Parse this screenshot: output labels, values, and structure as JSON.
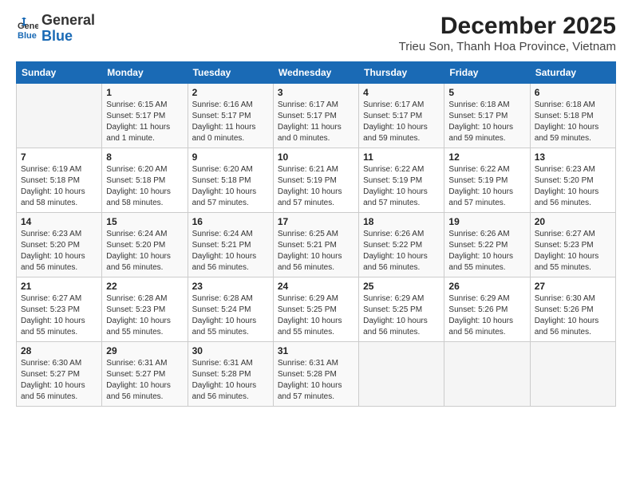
{
  "logo": {
    "general": "General",
    "blue": "Blue"
  },
  "header": {
    "month": "December 2025",
    "location": "Trieu Son, Thanh Hoa Province, Vietnam"
  },
  "weekdays": [
    "Sunday",
    "Monday",
    "Tuesday",
    "Wednesday",
    "Thursday",
    "Friday",
    "Saturday"
  ],
  "weeks": [
    [
      {
        "day": "",
        "sunrise": "",
        "sunset": "",
        "daylight": ""
      },
      {
        "day": "1",
        "sunrise": "Sunrise: 6:15 AM",
        "sunset": "Sunset: 5:17 PM",
        "daylight": "Daylight: 11 hours and 1 minute."
      },
      {
        "day": "2",
        "sunrise": "Sunrise: 6:16 AM",
        "sunset": "Sunset: 5:17 PM",
        "daylight": "Daylight: 11 hours and 0 minutes."
      },
      {
        "day": "3",
        "sunrise": "Sunrise: 6:17 AM",
        "sunset": "Sunset: 5:17 PM",
        "daylight": "Daylight: 11 hours and 0 minutes."
      },
      {
        "day": "4",
        "sunrise": "Sunrise: 6:17 AM",
        "sunset": "Sunset: 5:17 PM",
        "daylight": "Daylight: 10 hours and 59 minutes."
      },
      {
        "day": "5",
        "sunrise": "Sunrise: 6:18 AM",
        "sunset": "Sunset: 5:17 PM",
        "daylight": "Daylight: 10 hours and 59 minutes."
      },
      {
        "day": "6",
        "sunrise": "Sunrise: 6:18 AM",
        "sunset": "Sunset: 5:18 PM",
        "daylight": "Daylight: 10 hours and 59 minutes."
      }
    ],
    [
      {
        "day": "7",
        "sunrise": "Sunrise: 6:19 AM",
        "sunset": "Sunset: 5:18 PM",
        "daylight": "Daylight: 10 hours and 58 minutes."
      },
      {
        "day": "8",
        "sunrise": "Sunrise: 6:20 AM",
        "sunset": "Sunset: 5:18 PM",
        "daylight": "Daylight: 10 hours and 58 minutes."
      },
      {
        "day": "9",
        "sunrise": "Sunrise: 6:20 AM",
        "sunset": "Sunset: 5:18 PM",
        "daylight": "Daylight: 10 hours and 57 minutes."
      },
      {
        "day": "10",
        "sunrise": "Sunrise: 6:21 AM",
        "sunset": "Sunset: 5:19 PM",
        "daylight": "Daylight: 10 hours and 57 minutes."
      },
      {
        "day": "11",
        "sunrise": "Sunrise: 6:22 AM",
        "sunset": "Sunset: 5:19 PM",
        "daylight": "Daylight: 10 hours and 57 minutes."
      },
      {
        "day": "12",
        "sunrise": "Sunrise: 6:22 AM",
        "sunset": "Sunset: 5:19 PM",
        "daylight": "Daylight: 10 hours and 57 minutes."
      },
      {
        "day": "13",
        "sunrise": "Sunrise: 6:23 AM",
        "sunset": "Sunset: 5:20 PM",
        "daylight": "Daylight: 10 hours and 56 minutes."
      }
    ],
    [
      {
        "day": "14",
        "sunrise": "Sunrise: 6:23 AM",
        "sunset": "Sunset: 5:20 PM",
        "daylight": "Daylight: 10 hours and 56 minutes."
      },
      {
        "day": "15",
        "sunrise": "Sunrise: 6:24 AM",
        "sunset": "Sunset: 5:20 PM",
        "daylight": "Daylight: 10 hours and 56 minutes."
      },
      {
        "day": "16",
        "sunrise": "Sunrise: 6:24 AM",
        "sunset": "Sunset: 5:21 PM",
        "daylight": "Daylight: 10 hours and 56 minutes."
      },
      {
        "day": "17",
        "sunrise": "Sunrise: 6:25 AM",
        "sunset": "Sunset: 5:21 PM",
        "daylight": "Daylight: 10 hours and 56 minutes."
      },
      {
        "day": "18",
        "sunrise": "Sunrise: 6:26 AM",
        "sunset": "Sunset: 5:22 PM",
        "daylight": "Daylight: 10 hours and 56 minutes."
      },
      {
        "day": "19",
        "sunrise": "Sunrise: 6:26 AM",
        "sunset": "Sunset: 5:22 PM",
        "daylight": "Daylight: 10 hours and 55 minutes."
      },
      {
        "day": "20",
        "sunrise": "Sunrise: 6:27 AM",
        "sunset": "Sunset: 5:23 PM",
        "daylight": "Daylight: 10 hours and 55 minutes."
      }
    ],
    [
      {
        "day": "21",
        "sunrise": "Sunrise: 6:27 AM",
        "sunset": "Sunset: 5:23 PM",
        "daylight": "Daylight: 10 hours and 55 minutes."
      },
      {
        "day": "22",
        "sunrise": "Sunrise: 6:28 AM",
        "sunset": "Sunset: 5:23 PM",
        "daylight": "Daylight: 10 hours and 55 minutes."
      },
      {
        "day": "23",
        "sunrise": "Sunrise: 6:28 AM",
        "sunset": "Sunset: 5:24 PM",
        "daylight": "Daylight: 10 hours and 55 minutes."
      },
      {
        "day": "24",
        "sunrise": "Sunrise: 6:29 AM",
        "sunset": "Sunset: 5:25 PM",
        "daylight": "Daylight: 10 hours and 55 minutes."
      },
      {
        "day": "25",
        "sunrise": "Sunrise: 6:29 AM",
        "sunset": "Sunset: 5:25 PM",
        "daylight": "Daylight: 10 hours and 56 minutes."
      },
      {
        "day": "26",
        "sunrise": "Sunrise: 6:29 AM",
        "sunset": "Sunset: 5:26 PM",
        "daylight": "Daylight: 10 hours and 56 minutes."
      },
      {
        "day": "27",
        "sunrise": "Sunrise: 6:30 AM",
        "sunset": "Sunset: 5:26 PM",
        "daylight": "Daylight: 10 hours and 56 minutes."
      }
    ],
    [
      {
        "day": "28",
        "sunrise": "Sunrise: 6:30 AM",
        "sunset": "Sunset: 5:27 PM",
        "daylight": "Daylight: 10 hours and 56 minutes."
      },
      {
        "day": "29",
        "sunrise": "Sunrise: 6:31 AM",
        "sunset": "Sunset: 5:27 PM",
        "daylight": "Daylight: 10 hours and 56 minutes."
      },
      {
        "day": "30",
        "sunrise": "Sunrise: 6:31 AM",
        "sunset": "Sunset: 5:28 PM",
        "daylight": "Daylight: 10 hours and 56 minutes."
      },
      {
        "day": "31",
        "sunrise": "Sunrise: 6:31 AM",
        "sunset": "Sunset: 5:28 PM",
        "daylight": "Daylight: 10 hours and 57 minutes."
      },
      {
        "day": "",
        "sunrise": "",
        "sunset": "",
        "daylight": ""
      },
      {
        "day": "",
        "sunrise": "",
        "sunset": "",
        "daylight": ""
      },
      {
        "day": "",
        "sunrise": "",
        "sunset": "",
        "daylight": ""
      }
    ]
  ]
}
